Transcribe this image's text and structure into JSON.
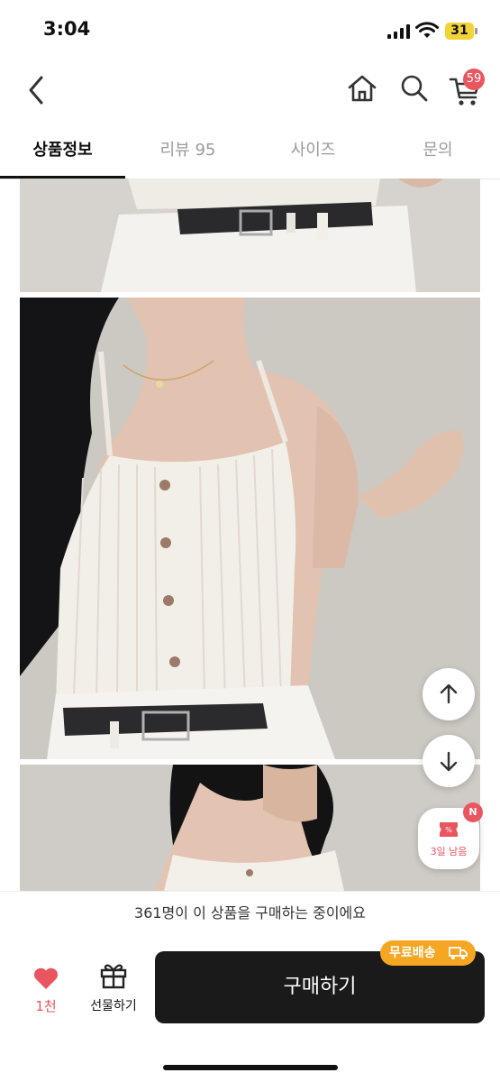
{
  "status": {
    "time": "3:04",
    "battery": "31"
  },
  "header": {
    "cart_count": "59"
  },
  "tabs": [
    {
      "label": "상품정보",
      "active": true
    },
    {
      "label": "리뷰 95",
      "active": false
    },
    {
      "label": "사이즈",
      "active": false
    },
    {
      "label": "문의",
      "active": false
    }
  ],
  "coupon": {
    "badge": "N",
    "label": "3일 남음"
  },
  "banner": {
    "text": "361명이 이 상품을 구매하는 중이에요"
  },
  "bottom": {
    "like_count": "1천",
    "gift_label": "선물하기",
    "buy_label": "구매하기",
    "free_shipping": "무료배송"
  },
  "colors": {
    "accent_red": "#e9565f",
    "buy_button": "#1a1a1a",
    "free_badge": "#f5a623"
  }
}
